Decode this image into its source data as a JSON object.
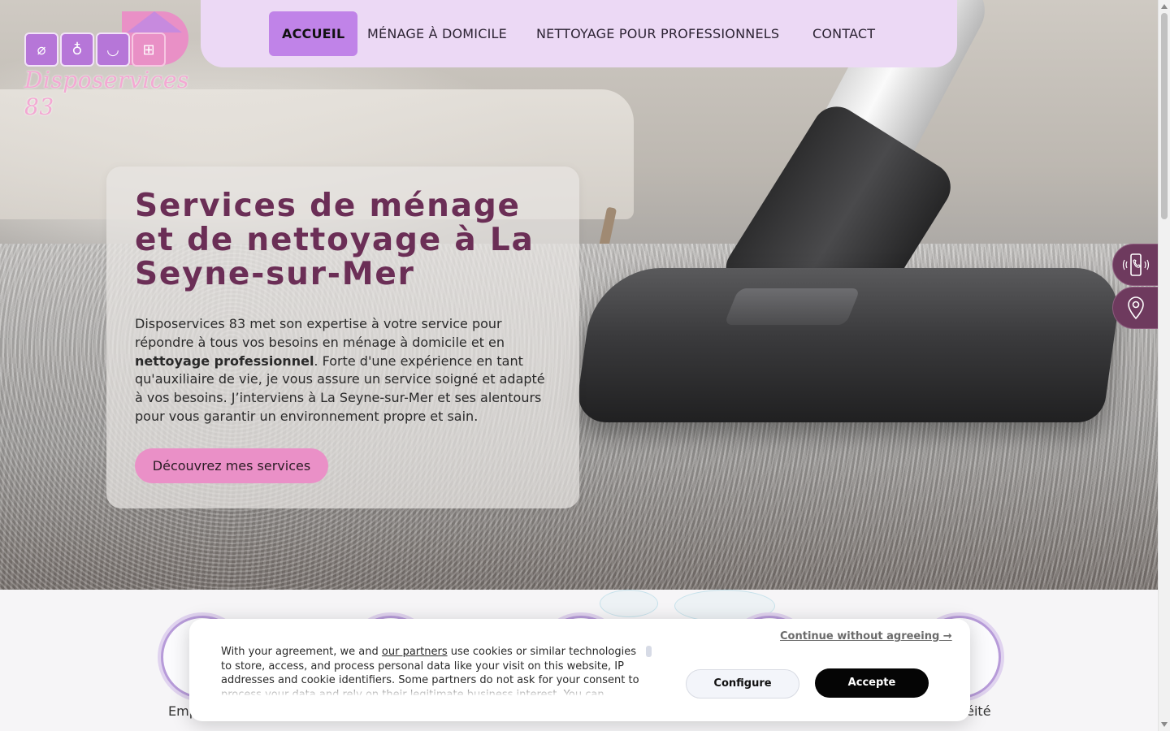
{
  "brand": {
    "logo_text": "Disposervices 83",
    "accent": "#c083e8",
    "pink": "#ea90c7",
    "title_color": "#6b2e56"
  },
  "nav": {
    "items": [
      {
        "label": "ACCUEIL",
        "active": true
      },
      {
        "label": "MÉNAGE À DOMICILE",
        "active": false
      },
      {
        "label": "NETTOYAGE POUR PROFESSIONNELS",
        "active": false
      },
      {
        "label": "CONTACT",
        "active": false
      }
    ]
  },
  "hero": {
    "title": "Services de ménage et de nettoyage à La Seyne-sur-Mer",
    "desc_part1": "Disposervices 83 met son expertise à votre service pour répondre à tous vos besoins en ménage à domicile et en ",
    "desc_bold": "nettoyage professionnel",
    "desc_part2": ". Forte d'une expérience en tant qu'auxiliaire de vie, je vous assure un service soigné et adapté à vos besoins. J’interviens à La Seyne-sur-Mer et ses alentours pour vous garantir un environnement propre et sain.",
    "cta": "Découvrez mes services"
  },
  "side_buttons": [
    {
      "icon": "phone-icon"
    },
    {
      "icon": "location-pin-icon"
    }
  ],
  "features": {
    "label_left": "Emp",
    "label_right": "néité"
  },
  "cookie": {
    "text_before_link": "With your agreement, we and ",
    "link": "our partners",
    "text_after_link": " use cookies or similar technologies to store, access, and process personal data like your visit on this website, IP addresses and cookie identifiers. Some partners do not ask for your consent to process your data and rely on their legitimate business interest. You can",
    "continue": "Continue without agreeing →",
    "configure": "Configure",
    "accept": "Accepte"
  }
}
